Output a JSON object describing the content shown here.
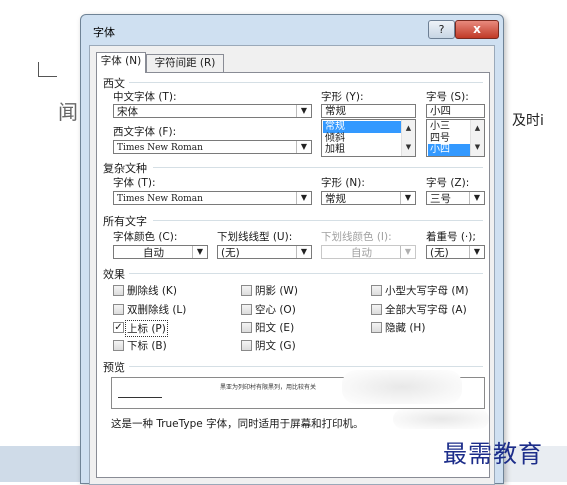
{
  "background": {
    "left_char": "闻",
    "right_text": "及时i"
  },
  "watermark": "最需教育",
  "dialog": {
    "title": "字体",
    "help_button": "?",
    "close_button": "x",
    "tabs": [
      {
        "label": "字体 (N)",
        "active": true
      },
      {
        "label": "字符间距 (R)",
        "active": false
      }
    ]
  },
  "western": {
    "group": "西文",
    "chinese_font_label": "中文字体 (T):",
    "chinese_font_value": "宋体",
    "western_font_label": "西文字体 (F):",
    "western_font_value": "Times New Roman",
    "style_label": "字形 (Y):",
    "style_value": "常规",
    "style_list": [
      "常规",
      "倾斜",
      "加粗"
    ],
    "size_label": "字号 (S):",
    "size_value": "小四",
    "size_list": [
      "小三",
      "四号",
      "小四"
    ]
  },
  "complex": {
    "group": "复杂文种",
    "font_label": "字体 (T):",
    "font_value": "Times New Roman",
    "style_label": "字形 (N):",
    "style_value": "常规",
    "size_label": "字号 (Z):",
    "size_value": "三号"
  },
  "all_text": {
    "group": "所有文字",
    "color_label": "字体颜色 (C):",
    "color_value": "自动",
    "underline_label": "下划线线型 (U):",
    "underline_value": "(无)",
    "underline_color_label": "下划线颜色 (I):",
    "underline_color_value": "自动",
    "emphasis_label": "着重号 (·);",
    "emphasis_value": "(无)"
  },
  "effects": {
    "group": "效果",
    "items": [
      {
        "label": "删除线 (K)",
        "checked": false
      },
      {
        "label": "双删除线 (L)",
        "checked": false
      },
      {
        "label": "上标 (P)",
        "checked": true
      },
      {
        "label": "下标 (B)",
        "checked": false
      },
      {
        "label": "阴影 (W)",
        "checked": false
      },
      {
        "label": "空心 (O)",
        "checked": false
      },
      {
        "label": "阳文 (E)",
        "checked": false
      },
      {
        "label": "阴文 (G)",
        "checked": false
      },
      {
        "label": "小型大写字母 (M)",
        "checked": false
      },
      {
        "label": "全部大写字母 (A)",
        "checked": false
      },
      {
        "label": "隐藏 (H)",
        "checked": false
      }
    ]
  },
  "preview": {
    "group": "预览",
    "sample_text": "黑亚为列印村有限黑列，用比较有关",
    "note": "这是一种 TrueType 字体，同时适用于屏幕和打印机。"
  }
}
